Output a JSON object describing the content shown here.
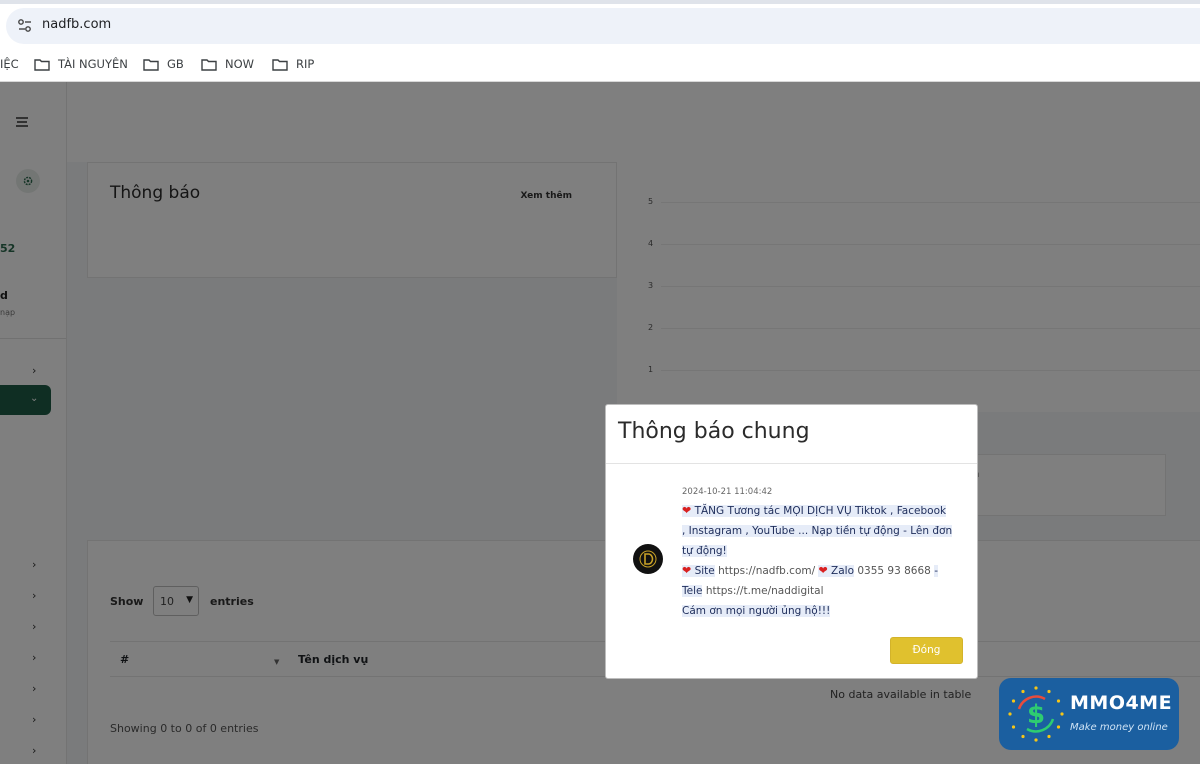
{
  "browser": {
    "url": "nadfb.com",
    "bookmarks": [
      {
        "label": "IỆC"
      },
      {
        "label": "TÀI NGUYÊN"
      },
      {
        "label": "GB"
      },
      {
        "label": "NOW"
      },
      {
        "label": "RIP"
      }
    ]
  },
  "sidebar": {
    "balance_fragment": "52",
    "name_fragment": "d",
    "sub_fragment": "nạp"
  },
  "notification_card": {
    "title": "Thông báo",
    "more_link": "Xem thêm"
  },
  "chart": {
    "yticks": [
      "5",
      "4",
      "3",
      "2",
      "1"
    ]
  },
  "small_card": {
    "fragment": "n"
  },
  "table": {
    "show_label": "Show",
    "page_size": "10",
    "entries_label": "entries",
    "columns": [
      "#",
      "Tên dịch vụ"
    ],
    "empty_text": "No data available in table",
    "info": "Showing 0 to 0 of 0 entries"
  },
  "modal": {
    "title": "Thông báo chung",
    "timestamp": "2024-10-21 11:04:42",
    "line1_a": "TĂNG Tương tác MỌI DỊCH VỤ Tiktok , Facebook",
    "line1_b": ", Instagram , YouTube ... Nạp tiền tự động - Lên đơn",
    "line1_c": "tự động!",
    "site_label": "Site",
    "site_url": "https://nadfb.com/",
    "zalo_label": "Zalo",
    "zalo_number": "0355 93 8668",
    "dash": "-",
    "tele_label": "Tele",
    "tele_url": "https://t.me/naddigital",
    "thanks": "Cám ơn mọi người ủng hộ!!!",
    "close_label": "Đóng"
  },
  "watermark": {
    "title": "MMO4ME",
    "subtitle": "Make money online"
  },
  "colors": {
    "sidebar_active": "#1f5c46",
    "close_button": "#e0c12e",
    "watermark_bg": "#1b5fa0"
  }
}
